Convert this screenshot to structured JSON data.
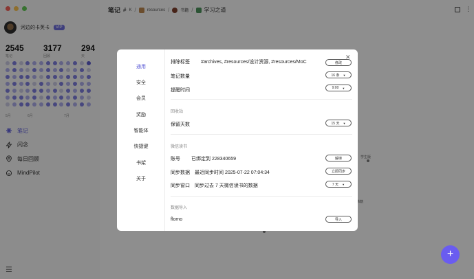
{
  "window": {
    "title": "笔记"
  },
  "header": {
    "title": "笔记",
    "hash": "#",
    "k_icon_text": "K",
    "crumbs": [
      "resources",
      "书籍",
      "学习之道"
    ],
    "separators": [
      "/",
      "/",
      "/"
    ]
  },
  "user": {
    "name": "河边的卡芙卡",
    "badge": "VIP"
  },
  "stats": [
    {
      "value": "2545",
      "label": "笔记"
    },
    {
      "value": "3177",
      "label": "回顾"
    },
    {
      "value": "294",
      "label": "天"
    }
  ],
  "heatmap_levels": [
    0,
    2,
    0,
    2,
    1,
    1,
    2,
    2,
    1,
    1,
    2,
    0,
    3,
    1,
    2,
    1,
    0,
    2,
    1,
    2,
    1,
    2,
    0,
    1,
    2,
    0,
    2,
    1,
    2,
    2,
    1,
    0,
    2,
    2,
    1,
    2,
    2,
    1,
    2,
    1,
    2,
    1,
    2,
    0,
    2,
    1,
    0,
    2,
    1,
    2,
    1,
    1,
    2,
    1,
    0,
    1,
    2,
    2,
    1,
    2,
    0,
    2,
    1,
    2,
    2,
    1,
    2,
    2,
    1,
    2,
    0,
    2,
    1,
    2,
    1,
    2,
    1,
    0,
    0,
    1,
    2,
    2,
    1,
    1,
    2,
    2,
    1,
    2,
    1,
    2,
    1
  ],
  "months": [
    "5月",
    "6月",
    "7月"
  ],
  "nav": [
    {
      "label": "笔记",
      "icon": "notes-icon",
      "active": true
    },
    {
      "label": "闪念",
      "icon": "flash-icon"
    },
    {
      "label": "每日回顾",
      "icon": "review-icon"
    },
    {
      "label": "MindPilot",
      "icon": "mindpilot-icon"
    }
  ],
  "graph": {
    "labels": [
      "学生版",
      "书籍"
    ]
  },
  "dialog": {
    "nav": [
      "通用",
      "安全",
      "会员",
      "奖励",
      "智能体",
      "快捷键",
      "书架",
      "关于"
    ],
    "active_nav": "通用",
    "rows": {
      "exclude_label": "排除标签",
      "exclude_value": "#archives, #resources/设计资源, #resources/MoC",
      "exclude_btn": "修改",
      "note_count_label": "笔记数量",
      "note_count_value": "16 条",
      "remind_label": "提醒时间",
      "remind_value": "9:00",
      "recycle_section": "回收站",
      "keep_days_label": "保留天数",
      "keep_days_value": "15 天",
      "weread_section": "微信读书",
      "account_label": "账号",
      "account_value": "已绑定到 228340659",
      "account_btn": "解绑",
      "sync_label": "同步数据",
      "sync_value": "最近同步时间 2025-07-22 07:04:34",
      "sync_btn": "立即同步",
      "window_label": "同步窗口",
      "window_value": "同步过去 7 天微信读书的数据",
      "window_select": "7 天",
      "import_section": "数据导入",
      "flomo_label": "flomo",
      "flomo_btn": "导入"
    }
  },
  "colors": {
    "accent": "#5b5bd6",
    "fab": "#6a5cf0"
  }
}
